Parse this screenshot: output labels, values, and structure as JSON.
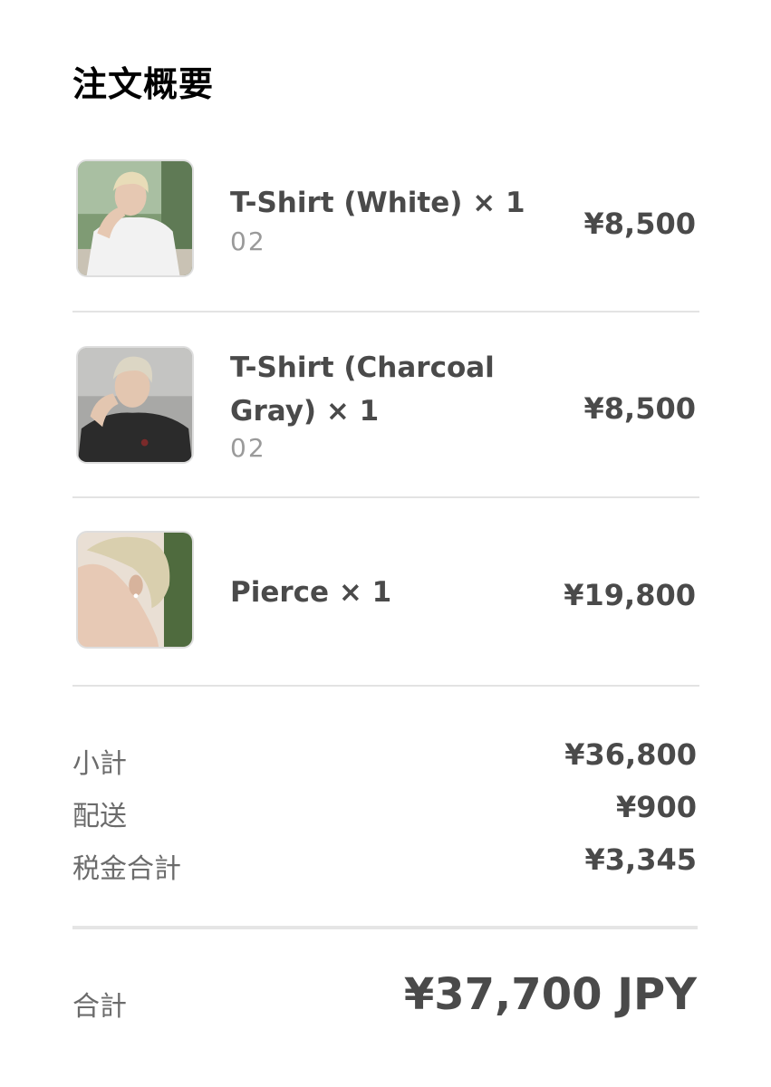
{
  "summary": {
    "title": "注文概要"
  },
  "items": [
    {
      "name": "T-Shirt (White) × 1",
      "variant": "02",
      "price": "¥8,500",
      "thumbnail": "photo-person-white-tshirt"
    },
    {
      "name": "T-Shirt (Charcoal Gray) × 1",
      "variant": "02",
      "price": "¥8,500",
      "thumbnail": "photo-person-charcoal-tshirt"
    },
    {
      "name": "Pierce × 1",
      "variant": "",
      "price": "¥19,800",
      "thumbnail": "photo-person-pierce"
    }
  ],
  "totals": {
    "subtotal_label": "小計",
    "subtotal_value": "¥36,800",
    "shipping_label": "配送",
    "shipping_value": "¥900",
    "tax_label": "税金合計",
    "tax_value": "¥3,345",
    "total_label": "合計",
    "total_value": "¥37,700 JPY"
  },
  "colors": {
    "text_primary": "#4a4a4a",
    "text_muted": "#9a9a9a",
    "divider": "#e3e3e3",
    "title": "#000000"
  }
}
